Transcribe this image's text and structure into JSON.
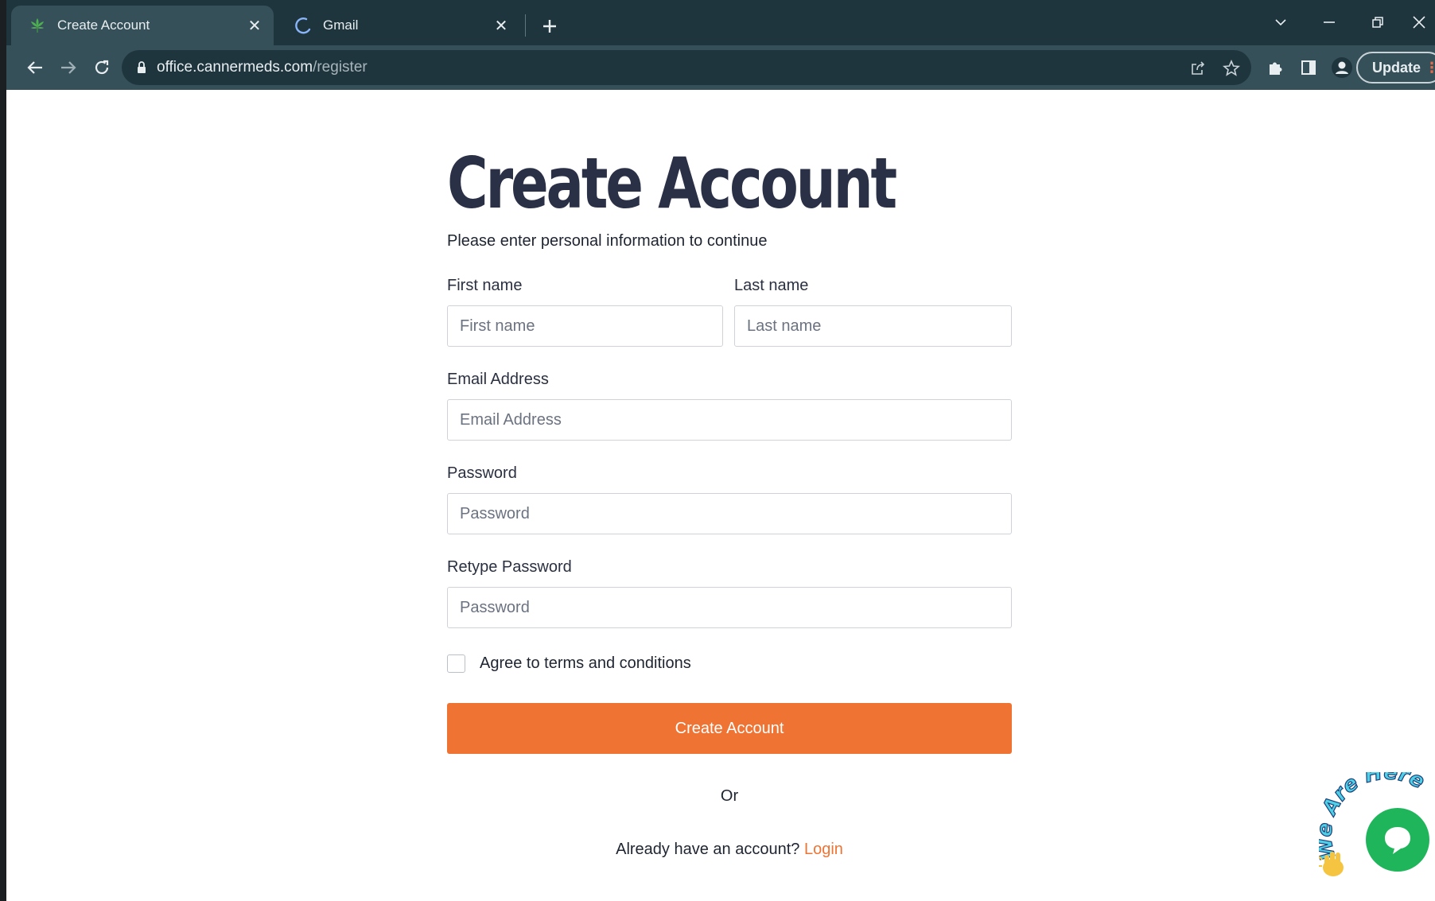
{
  "browser": {
    "tabs": [
      {
        "title": "Create Account",
        "active": true,
        "icon": "cannabis-leaf-icon"
      },
      {
        "title": "Gmail",
        "active": false,
        "icon": "loading-spinner-icon"
      }
    ],
    "url_domain": "office.cannermeds.com",
    "url_path": "/register",
    "update_label": "Update"
  },
  "form": {
    "title": "Create Account",
    "subtitle": "Please enter personal information to continue",
    "first_name": {
      "label": "First name",
      "placeholder": "First name",
      "value": ""
    },
    "last_name": {
      "label": "Last name",
      "placeholder": "Last name",
      "value": ""
    },
    "email": {
      "label": "Email Address",
      "placeholder": "Email Address",
      "value": ""
    },
    "password": {
      "label": "Password",
      "placeholder": "Password",
      "value": ""
    },
    "retype_password": {
      "label": "Retype Password",
      "placeholder": "Password",
      "value": ""
    },
    "terms_label": "Agree to terms and conditions",
    "terms_checked": false,
    "submit_label": "Create Account",
    "or_label": "Or",
    "login_prompt": "Already have an account?",
    "login_link": "Login"
  },
  "chat_widget": {
    "banner": "We Are Here",
    "icon": "chat-bubble-icon"
  },
  "colors": {
    "accent": "#ef7434",
    "title": "#2a3046",
    "chat": "#1fb55b",
    "tab_bar": "#1f353e",
    "toolbar": "#36505a"
  }
}
